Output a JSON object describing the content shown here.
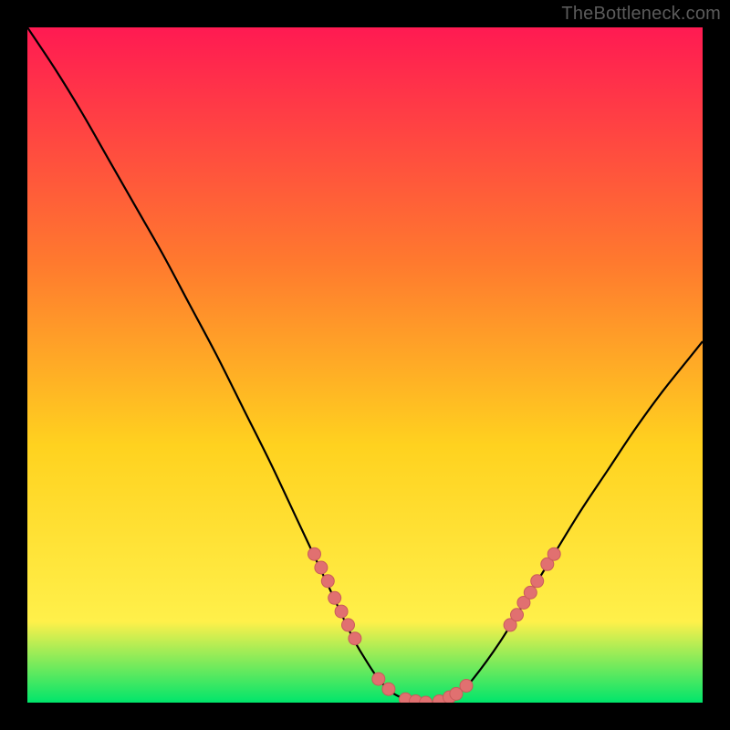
{
  "watermark": "TheBottleneck.com",
  "colors": {
    "page_bg": "#000000",
    "gradient_top": "#ff1a52",
    "gradient_mid1": "#ff7a2e",
    "gradient_mid2": "#ffd21f",
    "gradient_mid3": "#fff04a",
    "gradient_bottom": "#00e56b",
    "curve": "#000000",
    "marker_fill": "#e17070",
    "marker_stroke": "#c95b5b"
  },
  "chart_data": {
    "type": "line",
    "title": "",
    "xlabel": "",
    "ylabel": "",
    "xlim": [
      0,
      100
    ],
    "ylim": [
      0,
      100
    ],
    "grid": false,
    "legend": false,
    "series": [
      {
        "name": "bottleneck-curve",
        "x": [
          0,
          4,
          8,
          12,
          16,
          20,
          24,
          28,
          32,
          36,
          40,
          44,
          48,
          50,
          52,
          54,
          56,
          58,
          60,
          62,
          64,
          66,
          70,
          74,
          78,
          82,
          86,
          90,
          94,
          98,
          100
        ],
        "y": [
          100,
          94,
          87.5,
          80.5,
          73.5,
          66.5,
          59,
          51.5,
          43.5,
          35.5,
          27,
          18.5,
          10,
          6.5,
          3.5,
          1.5,
          0.5,
          0,
          0,
          0.5,
          1.5,
          3.5,
          9,
          15.5,
          22,
          28.5,
          34.5,
          40.5,
          46,
          51,
          53.5
        ]
      }
    ],
    "highlight_clusters": [
      {
        "name": "left-descending-dots",
        "points": [
          {
            "x": 42.5,
            "y": 22.0
          },
          {
            "x": 43.5,
            "y": 20.0
          },
          {
            "x": 44.5,
            "y": 18.0
          },
          {
            "x": 45.5,
            "y": 15.5
          },
          {
            "x": 46.5,
            "y": 13.5
          },
          {
            "x": 47.5,
            "y": 11.5
          },
          {
            "x": 48.5,
            "y": 9.5
          }
        ]
      },
      {
        "name": "valley-dots",
        "points": [
          {
            "x": 52.0,
            "y": 3.5
          },
          {
            "x": 53.5,
            "y": 2.0
          },
          {
            "x": 56.0,
            "y": 0.5
          },
          {
            "x": 57.5,
            "y": 0.2
          },
          {
            "x": 59.0,
            "y": 0.0
          },
          {
            "x": 61.0,
            "y": 0.2
          },
          {
            "x": 62.5,
            "y": 0.8
          },
          {
            "x": 63.5,
            "y": 1.3
          },
          {
            "x": 65.0,
            "y": 2.5
          }
        ]
      },
      {
        "name": "right-ascending-dots",
        "points": [
          {
            "x": 71.5,
            "y": 11.5
          },
          {
            "x": 72.5,
            "y": 13.0
          },
          {
            "x": 73.5,
            "y": 14.8
          },
          {
            "x": 74.5,
            "y": 16.3
          },
          {
            "x": 75.5,
            "y": 18.0
          },
          {
            "x": 77.0,
            "y": 20.5
          },
          {
            "x": 78.0,
            "y": 22.0
          }
        ]
      }
    ]
  }
}
